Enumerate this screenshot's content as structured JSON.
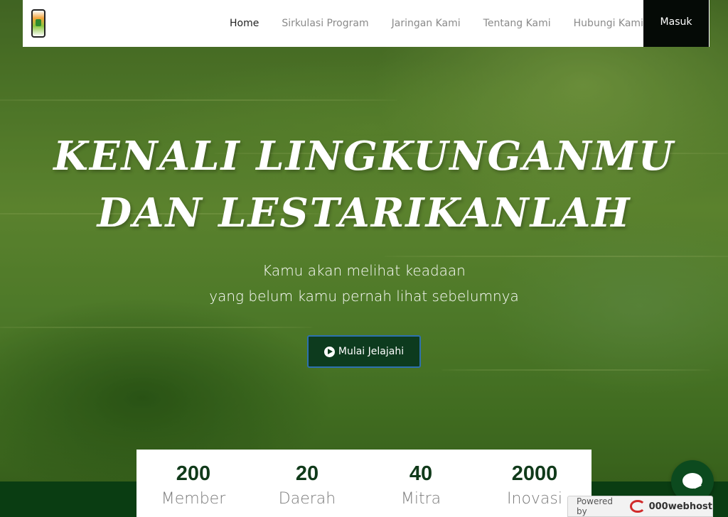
{
  "nav": {
    "logo_icon": "phone-plant-logo",
    "links": [
      "Home",
      "Sirkulasi Program",
      "Jaringan Kami",
      "Tentang Kami",
      "Hubungi Kami"
    ],
    "login": "Masuk"
  },
  "hero": {
    "headline_line1": "KENALI LINGKUNGANMU",
    "headline_line2": "DAN LESTARIKANLAH",
    "sub_line1": "Kamu akan melihat keadaan",
    "sub_line2": "yang belum kamu pernah lihat sebelumnya",
    "cta_label": "Mulai Jelajahi",
    "cta_icon": "play-circle-icon"
  },
  "stats": [
    {
      "value": "200",
      "label": "Member"
    },
    {
      "value": "20",
      "label": "Daerah"
    },
    {
      "value": "40",
      "label": "Mitra"
    },
    {
      "value": "2000",
      "label": "Inovasi"
    }
  ],
  "chat_icon": "chat-bubble-icon",
  "powered": {
    "prefix": "Powered by",
    "brand": "000webhost"
  },
  "colors": {
    "dark_green": "#0a3d12",
    "login_bg": "#050a06",
    "cta_bg": "#0d3b1e"
  }
}
